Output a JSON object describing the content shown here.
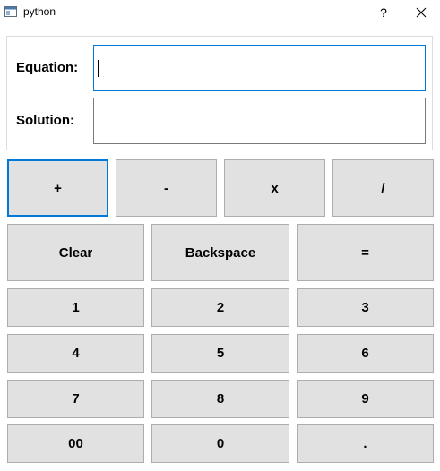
{
  "window": {
    "title": "python",
    "help_label": "?"
  },
  "form": {
    "equation_label": "Equation:",
    "equation_value": "",
    "solution_label": "Solution:",
    "solution_value": ""
  },
  "operators": [
    "+",
    "-",
    "x",
    "/"
  ],
  "actions": [
    "Clear",
    "Backspace",
    "="
  ],
  "keypad": [
    [
      "1",
      "2",
      "3"
    ],
    [
      "4",
      "5",
      "6"
    ],
    [
      "7",
      "8",
      "9"
    ],
    [
      "00",
      "0",
      "."
    ]
  ],
  "colors": {
    "accent": "#0078d7",
    "button_bg": "#e1e1e1",
    "button_border": "#adadad"
  }
}
